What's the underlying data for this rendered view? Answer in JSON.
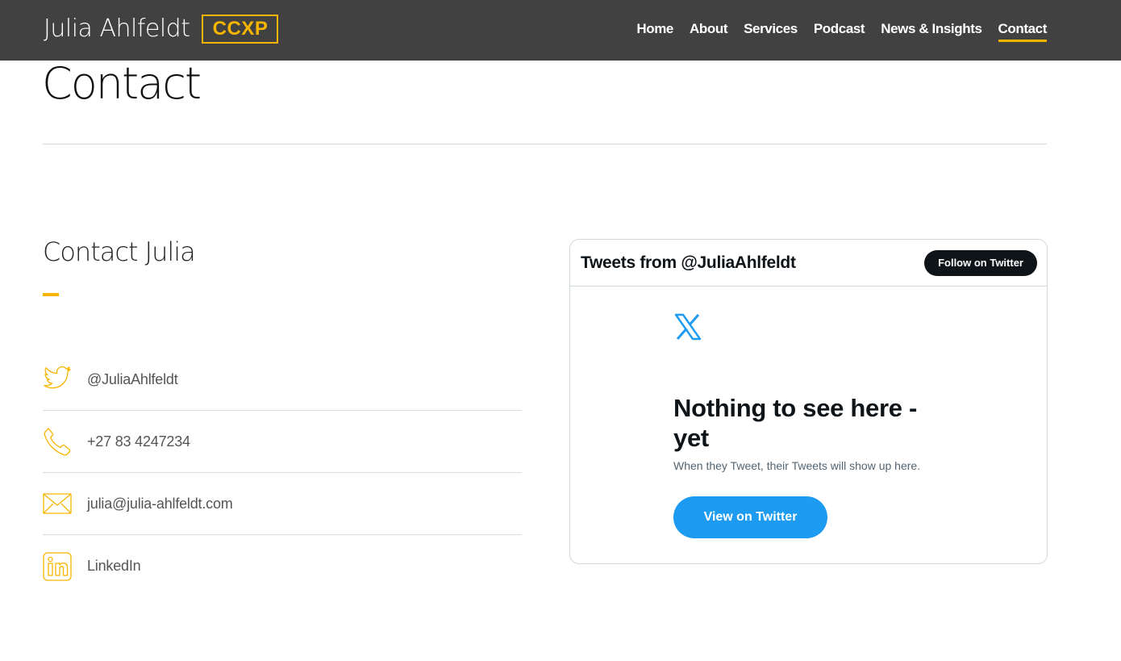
{
  "header": {
    "brand_name": "Julia Ahlfeldt",
    "brand_badge": "CCXP",
    "accent_color": "#f7b500",
    "nav": [
      {
        "label": "Home",
        "active": false
      },
      {
        "label": "About",
        "active": false
      },
      {
        "label": "Services",
        "active": false
      },
      {
        "label": "Podcast",
        "active": false
      },
      {
        "label": "News & Insights",
        "active": false
      },
      {
        "label": "Contact",
        "active": true
      }
    ]
  },
  "page": {
    "title": "Contact"
  },
  "contact": {
    "section_title": "Contact Julia",
    "items": [
      {
        "icon": "twitter-icon",
        "text": "@JuliaAhlfeldt"
      },
      {
        "icon": "phone-icon",
        "text": "+27 83 4247234"
      },
      {
        "icon": "email-icon",
        "text": "julia@julia-ahlfeldt.com"
      },
      {
        "icon": "linkedin-icon",
        "text": "LinkedIn"
      }
    ]
  },
  "twitter_widget": {
    "header_title": "Tweets from @JuliaAhlfeldt",
    "follow_label": "Follow on Twitter",
    "logo_icon": "x-logo-icon",
    "empty_title": "Nothing to see here - yet",
    "empty_subtitle": "When they Tweet, their Tweets will show up here.",
    "view_label": "View on Twitter",
    "button_color": "#1d9bf0"
  }
}
